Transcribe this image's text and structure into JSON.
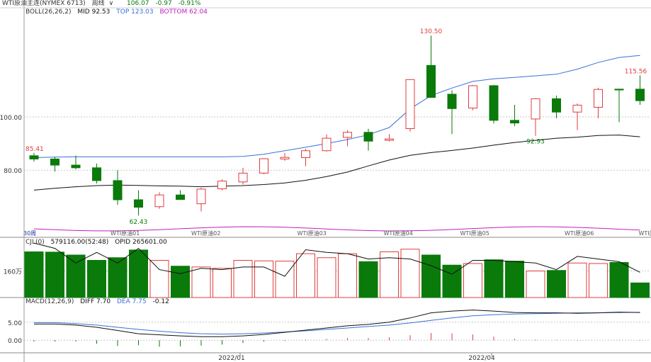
{
  "header": {
    "symbol_title": "WTI原油主连(NYMEX 6713)",
    "period": "周线",
    "period_arrow": "∨",
    "last_price": "106.07",
    "change": "-0.97",
    "change_pct": "-0.91%"
  },
  "boll": {
    "label": "BOLL(26,26,2)",
    "mid": "MID 92.53",
    "top": "TOP 123.03",
    "bottom": "BOTTOM 62.04"
  },
  "cjl": {
    "label": "CJL(0)",
    "vol": "579116.00(52:48)",
    "opid": "OPID 265601.00",
    "axis_label": "160万"
  },
  "macd": {
    "label": "MACD(12,26,9)",
    "diff": "DIFF 7.70",
    "dea": "DEA 7.75",
    "macd_val": "-0.12",
    "ticks": [
      "5.00",
      "0.00"
    ]
  },
  "price_axis": [
    "100.00",
    "80.00"
  ],
  "annotations": {
    "high": "130.50",
    "start": "85.41",
    "low": "62.43",
    "mid_low": "92.93",
    "recent_high": "115.56"
  },
  "period_label": "30周",
  "sub_labels": [
    "WTI原油01",
    "WTI原油02",
    "WTI原油03",
    "WTI原油04",
    "WTI原油05",
    "WTI原油06",
    "WTI原"
  ],
  "date_labels": [
    "2022/01",
    "2022/04"
  ],
  "colors": {
    "up": "#e03c3c",
    "down": "#0a7a0a",
    "mid_line": "#111111",
    "top_line": "#3a6fd8",
    "bottom_line": "#c020c0",
    "grid": "#c8c8c8"
  },
  "chart_data": {
    "type": "candlestick",
    "series": [
      {
        "name": "K",
        "ohlc": [
          [
            85.41,
            86.5,
            83.2,
            84.2
          ],
          [
            84.2,
            85.0,
            79.5,
            81.9
          ],
          [
            81.9,
            85.5,
            80.3,
            80.9
          ],
          [
            80.9,
            82.5,
            75.0,
            76.1
          ],
          [
            76.1,
            80.0,
            67.0,
            68.9
          ],
          [
            68.9,
            72.5,
            63.0,
            66.1
          ],
          [
            66.3,
            71.7,
            65.5,
            70.7
          ],
          [
            70.7,
            72.5,
            69.2,
            69.0
          ],
          [
            67.4,
            73.4,
            64.5,
            72.9
          ],
          [
            73.0,
            76.5,
            72.4,
            75.9
          ],
          [
            75.6,
            80.9,
            74.6,
            78.9
          ],
          [
            78.9,
            84.5,
            78.5,
            84.3
          ],
          [
            84.2,
            86.5,
            83.5,
            84.8
          ],
          [
            84.7,
            88.0,
            81.5,
            87.3
          ],
          [
            87.3,
            93.4,
            87.0,
            92.0
          ],
          [
            92.3,
            95.0,
            89.0,
            94.2
          ],
          [
            94.2,
            95.5,
            87.3,
            90.9
          ],
          [
            91.2,
            93.5,
            90.8,
            91.7
          ],
          [
            95.6,
            105.0,
            94.5,
            114.0
          ],
          [
            119.3,
            130.5,
            110.0,
            107.3
          ],
          [
            108.5,
            110.0,
            93.5,
            103.1
          ],
          [
            103.3,
            112.0,
            102.5,
            111.7
          ],
          [
            111.7,
            112.0,
            97.5,
            98.7
          ],
          [
            98.7,
            104.5,
            96.5,
            97.7
          ],
          [
            99.2,
            107.0,
            92.9,
            106.8
          ],
          [
            106.8,
            108.0,
            99.5,
            101.8
          ],
          [
            101.8,
            105.0,
            95.0,
            104.4
          ],
          [
            103.6,
            110.9,
            99.5,
            110.3
          ],
          [
            110.4,
            110.5,
            98.0,
            110.1
          ],
          [
            110.4,
            115.56,
            104.5,
            106.07
          ]
        ]
      },
      {
        "name": "MID",
        "values": [
          72.5,
          73.2,
          73.8,
          74.2,
          74.4,
          74.3,
          74.1,
          74.0,
          73.8,
          74.0,
          74.2,
          74.6,
          75.2,
          76.2,
          77.6,
          79.3,
          81.6,
          83.8,
          85.6,
          86.6,
          87.4,
          88.3,
          89.4,
          90.4,
          91.2,
          92.0,
          92.4,
          93.0,
          93.2,
          92.53
        ]
      },
      {
        "name": "TOP",
        "values": [
          84.7,
          84.9,
          85.0,
          85.0,
          85.0,
          85.0,
          85.0,
          85.0,
          85.0,
          85.0,
          85.2,
          86.0,
          87.3,
          88.6,
          90.0,
          91.5,
          93.3,
          96.0,
          103.0,
          108.0,
          110.8,
          113.3,
          114.3,
          114.8,
          115.4,
          116.0,
          117.9,
          120.4,
          122.3,
          123.03
        ]
      },
      {
        "name": "VOL",
        "values": [
          1.72,
          1.71,
          1.6,
          1.4,
          1.5,
          1.79,
          1.4,
          1.18,
          1.15,
          1.1,
          1.4,
          1.38,
          1.37,
          1.65,
          1.5,
          1.65,
          1.35,
          1.72,
          1.82,
          1.6,
          1.22,
          1.28,
          1.42,
          1.37,
          1.0,
          1.02,
          1.3,
          1.28,
          1.32,
          0.55
        ]
      },
      {
        "name": "OPID",
        "values": [
          2.05,
          1.85,
          1.3,
          1.7,
          1.3,
          1.85,
          1.05,
          0.9,
          1.1,
          1.05,
          1.15,
          1.15,
          0.8,
          1.8,
          1.7,
          1.65,
          1.45,
          1.5,
          1.45,
          1.2,
          0.88,
          1.4,
          1.4,
          1.35,
          1.3,
          1.05,
          1.55,
          1.45,
          1.35,
          0.95
        ]
      },
      {
        "name": "DIFF",
        "values": [
          4.5,
          4.5,
          4.2,
          3.6,
          2.7,
          1.8,
          1.5,
          1.2,
          1.0,
          1.0,
          1.2,
          1.6,
          2.2,
          2.8,
          3.4,
          4.0,
          4.4,
          5.0,
          6.2,
          7.6,
          8.1,
          8.4,
          8.1,
          7.7,
          7.6,
          7.6,
          7.5,
          7.6,
          7.8,
          7.7
        ]
      },
      {
        "name": "DEA",
        "values": [
          4.9,
          4.9,
          4.6,
          4.2,
          3.6,
          3.0,
          2.5,
          2.1,
          1.8,
          1.7,
          1.8,
          2.0,
          2.3,
          2.6,
          3.0,
          3.4,
          3.8,
          4.2,
          4.8,
          5.5,
          6.2,
          6.8,
          7.1,
          7.3,
          7.4,
          7.5,
          7.6,
          7.6,
          7.7,
          7.75
        ]
      },
      {
        "name": "MACD",
        "values": [
          -0.4,
          -0.4,
          -0.4,
          -1.0,
          -1.6,
          -1.4,
          -1.8,
          -1.7,
          -1.5,
          -1.2,
          -0.8,
          -0.4,
          -0.2,
          0.2,
          0.4,
          0.6,
          0.6,
          0.8,
          1.4,
          2.0,
          1.9,
          1.6,
          1.0,
          0.4,
          0.2,
          0.1,
          -0.1,
          0.0,
          0.1,
          -0.12
        ]
      }
    ],
    "ylim_price": [
      58,
      138
    ],
    "ylim_macd": [
      -3.5,
      9.5
    ]
  }
}
